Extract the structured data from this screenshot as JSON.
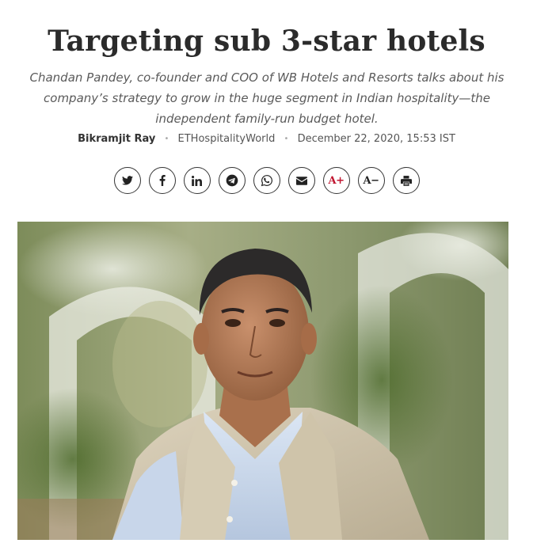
{
  "article": {
    "title": "Targeting sub 3-star hotels",
    "summary": "Chandan Pandey, co-founder and COO of WB Hotels and Resorts talks about his company’s strategy to grow in the huge segment in Indian hospitality—the independent family-run budget hotel.",
    "author": "Bikramjit Ray",
    "publication": "ETHospitalityWorld",
    "date": "December 22, 2020, 15:53 IST",
    "separator": "•"
  },
  "share": {
    "buttons": [
      {
        "name": "twitter",
        "icon": "twitter-icon"
      },
      {
        "name": "facebook",
        "icon": "facebook-icon"
      },
      {
        "name": "linkedin",
        "icon": "linkedin-icon"
      },
      {
        "name": "telegram",
        "icon": "telegram-icon"
      },
      {
        "name": "whatsapp",
        "icon": "whatsapp-icon"
      },
      {
        "name": "email",
        "icon": "envelope-icon"
      },
      {
        "name": "font-increase",
        "label": "A+"
      },
      {
        "name": "font-decrease",
        "label": "A−"
      },
      {
        "name": "print",
        "icon": "printer-icon"
      }
    ],
    "font_increase_label": "A+",
    "font_decrease_label": "A−"
  },
  "colors": {
    "title": "#2b2b2b",
    "summary": "#5a5a5a",
    "accent_red": "#c0152f",
    "border": "#333333"
  },
  "hero_image": {
    "subject": "portrait of a man in a beige vest and light blue shirt in front of white arches and greenery"
  }
}
